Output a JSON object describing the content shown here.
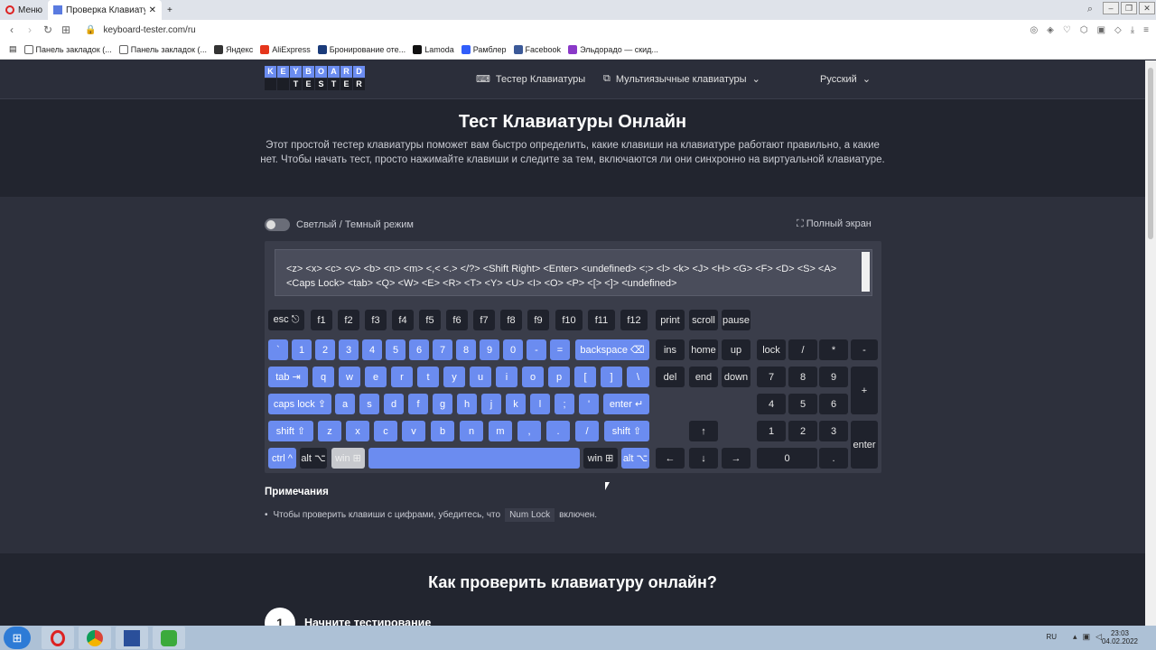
{
  "browser": {
    "menu_tab": "Меню",
    "active_tab": "Проверка Клавиатуры - Пр",
    "url": "keyboard-tester.com/ru",
    "bookmarks": [
      "Панель закладок (...",
      "Панель закладок (...",
      "Яндекс",
      "AliExpress",
      "Бронирование оте...",
      "Lamoda",
      "Рамблер",
      "Facebook",
      "Эльдорадо — скид..."
    ]
  },
  "header": {
    "logo_top": [
      "K",
      "E",
      "Y",
      "B",
      "O",
      "A",
      "R",
      "D"
    ],
    "logo_bottom": [
      "",
      "",
      "T",
      "E",
      "S",
      "T",
      "E",
      "R"
    ],
    "nav_tester": "Тестер Клавиатуры",
    "nav_multi": "Мультиязычные клавиатуры",
    "lang": "Русский"
  },
  "hero": {
    "title": "Тест Клавиатуры Онлайн",
    "desc": "Этот простой тестер клавиатуры поможет вам быстро определить, какие клавиши на клавиатуре работают правильно, а какие нет. Чтобы начать тест, просто нажимайте клавиши и следите за тем, включаются ли они синхронно на виртуальной клавиатуре."
  },
  "tool": {
    "mode_label": "Светлый / Темный режим",
    "fullscreen": "Полный экран",
    "log_text": "<z> <x> <c> <v> <b> <n> <m> <,< <.> </?> <Shift Right> <Enter> <undefined> <;> <l> <k> <J> <H> <G> <F> <D> <S> <A> <Caps Lock> <tab> <Q> <W> <E> <R> <T> <Y> <U> <I> <O> <P> <[> <]> <undefined>"
  },
  "keys": {
    "fn": [
      "esc ⎋",
      "f1",
      "f2",
      "f3",
      "f4",
      "f5",
      "f6",
      "f7",
      "f8",
      "f9",
      "f10",
      "f11",
      "f12"
    ],
    "sys": [
      "print",
      "scroll",
      "pause"
    ],
    "row1": [
      "`",
      "1",
      "2",
      "3",
      "4",
      "5",
      "6",
      "7",
      "8",
      "9",
      "0",
      "-",
      "=",
      "backspace ⌫"
    ],
    "row2": [
      "tab ⇥",
      "q",
      "w",
      "e",
      "r",
      "t",
      "y",
      "u",
      "i",
      "o",
      "p",
      "[",
      "]",
      "\\"
    ],
    "row3": [
      "caps lock ⇪",
      "a",
      "s",
      "d",
      "f",
      "g",
      "h",
      "j",
      "k",
      "l",
      ";",
      "'",
      "enter ↵"
    ],
    "row4": [
      "shift ⇧",
      "z",
      "x",
      "c",
      "v",
      "b",
      "n",
      "m",
      ",",
      ".",
      "/",
      "shift ⇧"
    ],
    "row5": [
      "ctrl ^",
      "alt ⌥",
      "win ⊞",
      "",
      "win ⊞",
      "alt ⌥"
    ],
    "nav1": [
      "ins",
      "home",
      "up"
    ],
    "nav2": [
      "del",
      "end",
      "down"
    ],
    "arrows": [
      "↑",
      "←",
      "↓",
      "→"
    ],
    "numpad": [
      "lock",
      "/",
      "*",
      "-",
      "7",
      "8",
      "9",
      "+",
      "4",
      "5",
      "6",
      "1",
      "2",
      "3",
      "enter",
      "0",
      "."
    ]
  },
  "notes": {
    "title": "Примечания",
    "text_before": "Чтобы проверить клавиши с цифрами, убедитесь, что",
    "badge": "Num Lock",
    "text_after": "включен."
  },
  "howto": {
    "title": "Как проверить клавиатуру онлайн?",
    "step_num": "1",
    "step_title": "Начните тестирование"
  },
  "taskbar": {
    "lang": "RU",
    "time": "23:03",
    "date": "04.02.2022"
  },
  "colors": {
    "accent": "#6b8cf0",
    "key_dark": "#1f222c",
    "bg": "#2b2e3a"
  }
}
